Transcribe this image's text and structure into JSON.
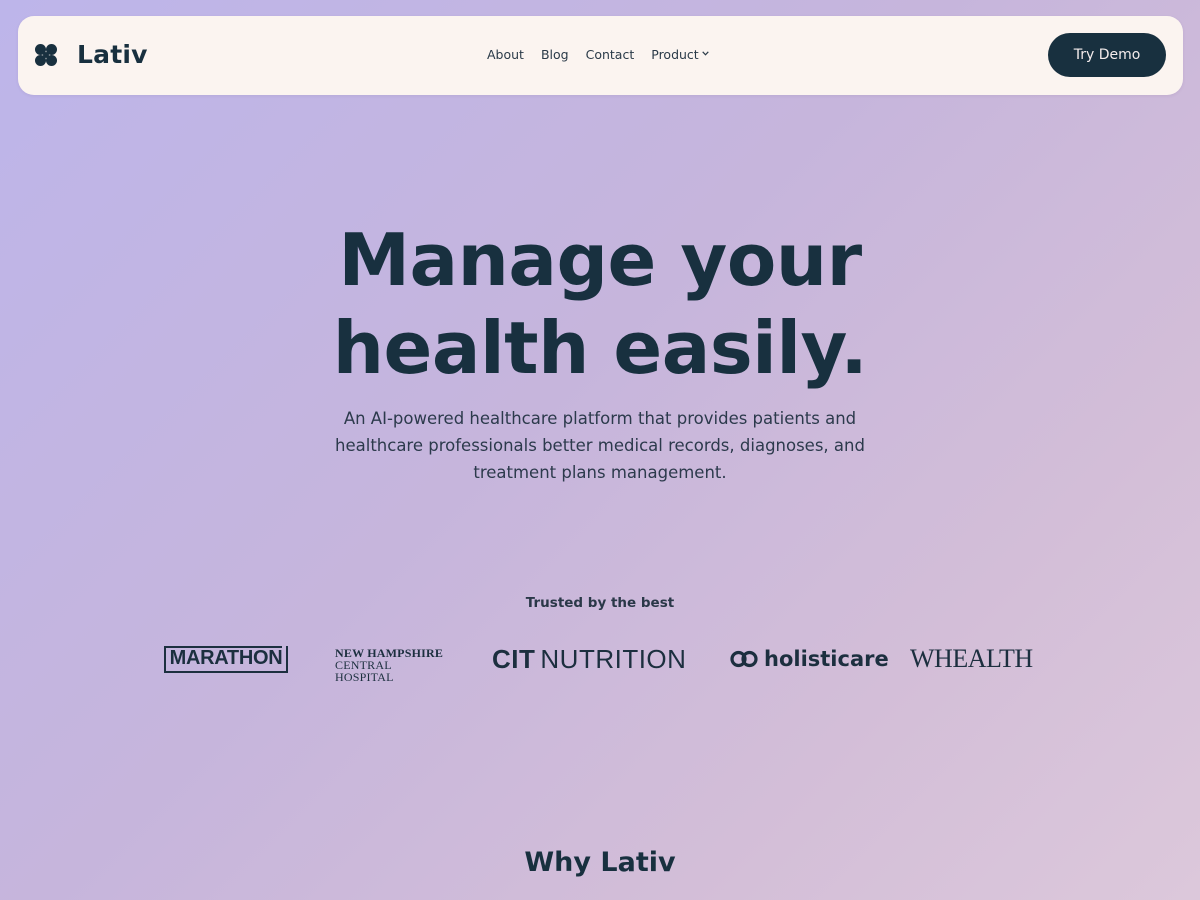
{
  "nav": {
    "brand": "Lativ",
    "links": [
      {
        "label": "About"
      },
      {
        "label": "Blog"
      },
      {
        "label": "Contact"
      },
      {
        "label": "Product"
      }
    ],
    "cta_label": "Try Demo"
  },
  "hero": {
    "title_line1": "Manage your",
    "title_line2": "health easily.",
    "subtitle": "An AI-powered healthcare platform that provides patients and healthcare professionals better medical records, diagnoses, and treatment plans management."
  },
  "trusted": {
    "heading": "Trusted by the best",
    "logos": {
      "marathon": "MARATHON",
      "nh_line1": "NEW HAMPSHIRE",
      "nh_line2": "CENTRAL HOSPITAL",
      "cit_bold": "CIT",
      "cit_rest": "NUTRITION",
      "holisticare": "holisticare",
      "whealth": "WHEALTH"
    }
  },
  "section": {
    "why_heading": "Why Lativ"
  },
  "colors": {
    "primary_dark": "#18303f",
    "nav_bg": "#fbf4f0",
    "gradient_start": "#bdb5ea",
    "gradient_end": "#dcc8db"
  },
  "icons": {
    "logo": "four-petal-logo-icon",
    "product_dropdown": "chevron-down-icon",
    "holisticare": "linked-rings-icon"
  }
}
